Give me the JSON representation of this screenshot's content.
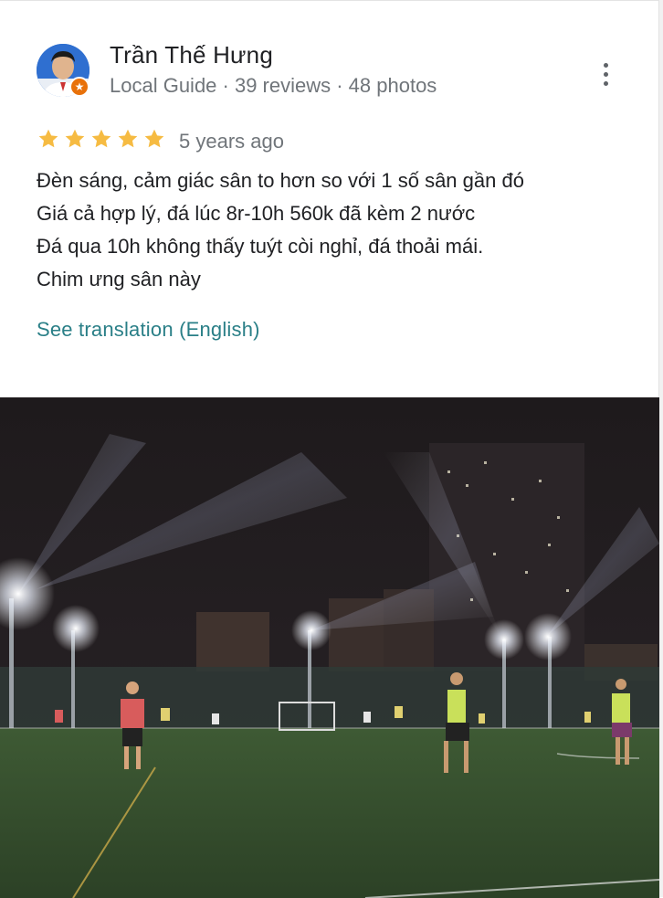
{
  "reviewer": {
    "name": "Trần Thế Hưng",
    "meta": "Local Guide · 39 reviews · 48 photos"
  },
  "rating": {
    "stars": 5,
    "max": 5,
    "time_ago": "5 years ago"
  },
  "review": {
    "lines": [
      "Đèn sáng, cảm giác sân to hơn so với 1 số sân gần đó",
      "Giá cả hợp lý, đá lúc 8r-10h 560k đã kèm 2 nước",
      "Đá qua 10h không thấy tuýt còi nghỉ, đá thoải mái.",
      "Chim ưng sân này"
    ]
  },
  "actions": {
    "see_translation": "See translation (English)"
  },
  "icons": {
    "menu": "more-vert-icon",
    "star": "star-icon",
    "badge": "local-guide-badge-icon"
  },
  "colors": {
    "star": "#f6bb42",
    "link": "#2a7f87",
    "badge": "#e8710a",
    "meta_text": "#70757a"
  }
}
